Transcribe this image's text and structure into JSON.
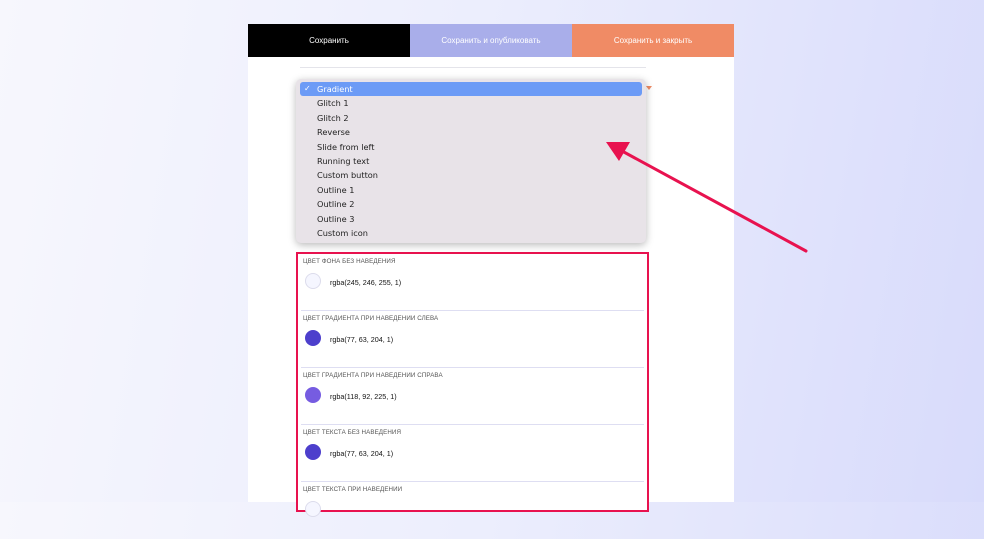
{
  "toolbar": {
    "save_label": "Сохранить",
    "publish_label": "Сохранить и опубликовать",
    "close_label": "Сохранить и закрыть"
  },
  "dropdown": {
    "check_glyph": "✓",
    "selected": "Gradient",
    "options": [
      "Gradient",
      "Glitch 1",
      "Glitch 2",
      "Reverse",
      "Slide from left",
      "Running text",
      "Custom button",
      "Outline 1",
      "Outline 2",
      "Outline 3",
      "Custom icon"
    ]
  },
  "colors": [
    {
      "label": "ЦВЕТ ФОНА БЕЗ НАВЕДЕНИЯ",
      "value": "rgba(245, 246, 255, 1)",
      "swatch": "#f5f6ff"
    },
    {
      "label": "ЦВЕТ ГРАДИЕНТА ПРИ НАВЕДЕНИИ СЛЕВА",
      "value": "rgba(77, 63, 204, 1)",
      "swatch": "#4d3fcc"
    },
    {
      "label": "ЦВЕТ ГРАДИЕНТА ПРИ НАВЕДЕНИИ СПРАВА",
      "value": "rgba(118, 92, 225, 1)",
      "swatch": "#765ce1"
    },
    {
      "label": "ЦВЕТ ТЕКСТА БЕЗ НАВЕДЕНИЯ",
      "value": "rgba(77, 63, 204, 1)",
      "swatch": "#4d3fcc"
    },
    {
      "label": "ЦВЕТ ТЕКСТА ПРИ НАВЕДЕНИИ",
      "value": "",
      "swatch": "#f5f6ff"
    }
  ],
  "accent": {
    "highlight": "#e8124f",
    "selection": "#6c9bf6"
  }
}
